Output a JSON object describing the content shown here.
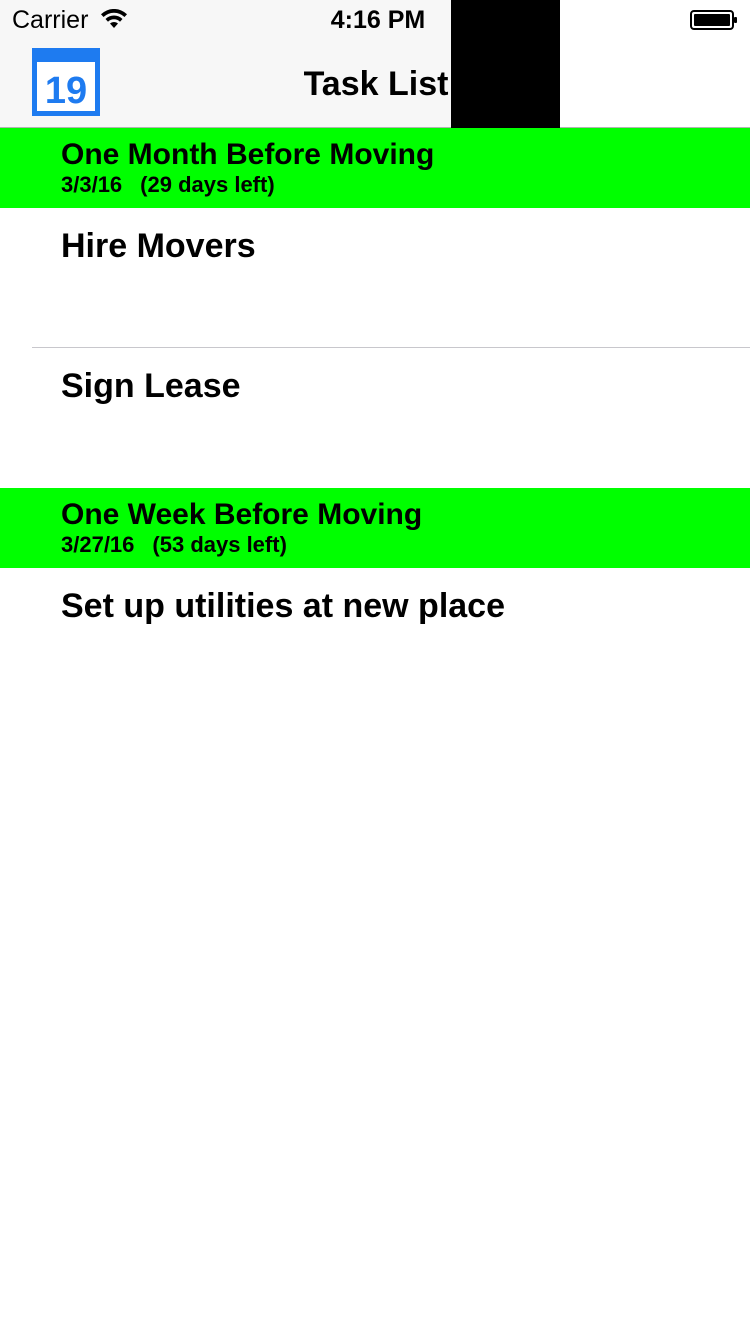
{
  "status_bar": {
    "carrier": "Carrier",
    "time": "4:16 PM"
  },
  "nav": {
    "title": "Task List",
    "calendar_icon_day": "19",
    "calendar_icon_color": "#1e7bf0"
  },
  "colors": {
    "section_header_bg": "#00ff00",
    "nav_bg": "#f7f7f7"
  },
  "sections": [
    {
      "title": "One Month Before Moving",
      "date": "3/3/16",
      "days_left": "(29 days left)",
      "tasks": [
        "Hire Movers",
        "Sign Lease"
      ]
    },
    {
      "title": "One Week Before Moving",
      "date": "3/27/16",
      "days_left": "(53 days left)",
      "tasks": [
        "Set up utilities at new place"
      ]
    }
  ]
}
